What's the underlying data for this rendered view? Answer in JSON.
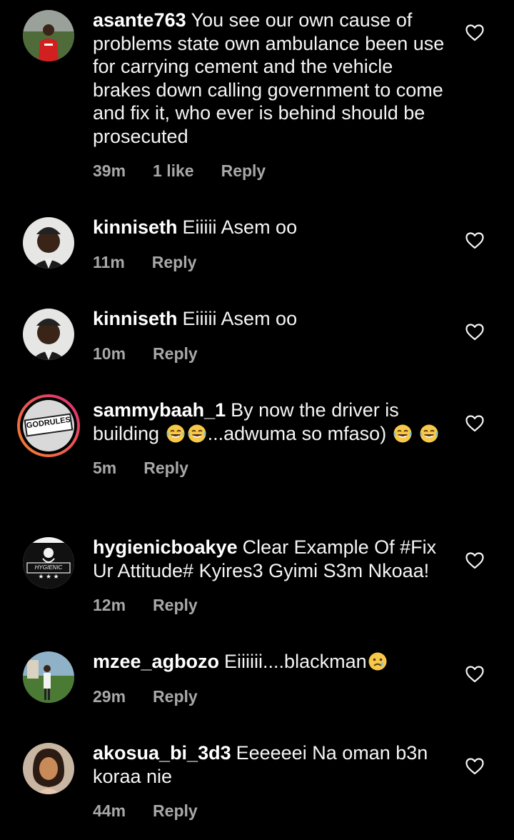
{
  "comments": [
    {
      "username": "asante763",
      "text": "You see our own cause of problems state own ambulance been use for carrying cement and the vehicle brakes down calling government to come and fix it, who ever is behind should be prosecuted",
      "time": "39m",
      "likes": "1 like",
      "reply": "Reply"
    },
    {
      "username": "kinniseth",
      "text": "Eiiiii Asem oo",
      "time": "11m",
      "reply": "Reply"
    },
    {
      "username": "kinniseth",
      "text": "Eiiiii Asem oo",
      "time": "10m",
      "reply": "Reply"
    },
    {
      "username": "sammybaah_1",
      "text_part1": "By now the driver is building",
      "text_part2": "...adwuma so mfaso)",
      "time": "5m",
      "reply": "Reply",
      "avatar_text": "GODRULES"
    },
    {
      "username": "hygienicboakye",
      "text": "Clear Example Of #Fix Ur Attitude# Kyires3 Gyimi S3m Nkoaa!",
      "time": "12m",
      "reply": "Reply",
      "avatar_text": "HYGIENIC"
    },
    {
      "username": "mzee_agbozo",
      "text": "Eiiiiii....blackman",
      "time": "29m",
      "reply": "Reply"
    },
    {
      "username": "akosua_bi_3d3",
      "text": "Eeeeeei Na oman b3n koraa nie",
      "time": "44m",
      "reply": "Reply"
    }
  ],
  "colors": {
    "background": "#000000",
    "text": "#f5f5f5",
    "meta": "#a8a8a8",
    "story_ring_start": "#f58529",
    "story_ring_end": "#dd2a7b"
  },
  "icons": {
    "like": "heart-outline-icon",
    "emoji_laugh": "tears-of-joy-emoji",
    "emoji_sad": "crying-face-emoji"
  }
}
